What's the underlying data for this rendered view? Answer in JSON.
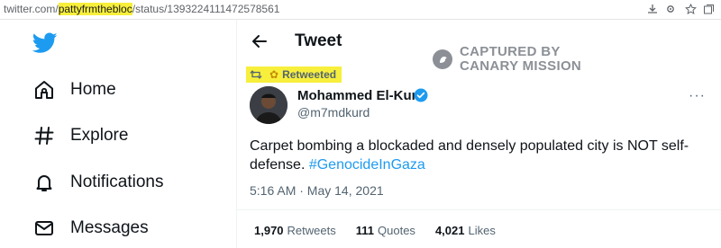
{
  "browser": {
    "url_domain": "twitter.com/",
    "url_highlight": "pattyfrmthebloc",
    "url_path": "/status/1393224111472578561"
  },
  "nav": {
    "items": [
      {
        "label": "Home",
        "icon": "home-icon"
      },
      {
        "label": "Explore",
        "icon": "hashtag-icon"
      },
      {
        "label": "Notifications",
        "icon": "bell-icon"
      },
      {
        "label": "Messages",
        "icon": "envelope-icon"
      }
    ]
  },
  "header": {
    "title": "Tweet"
  },
  "watermark": {
    "line1": "CAPTURED BY",
    "line2": "CANARY MISSION"
  },
  "tweet": {
    "retweeted_label": "Retweeted",
    "author_name": "Mohammed El-Kurd",
    "handle": "@m7mdkurd",
    "text_line1": "Carpet bombing a blockaded and densely populated city is NOT self-",
    "text_line2_prefix": "defense. ",
    "hashtag": "#GenocideInGaza",
    "timestamp": "5:16 AM · May 14, 2021",
    "stats": {
      "retweets_count": "1,970",
      "retweets_label": "Retweets",
      "quotes_count": "111",
      "quotes_label": "Quotes",
      "likes_count": "4,021",
      "likes_label": "Likes"
    }
  },
  "colors": {
    "accent": "#1d9bf0",
    "highlight": "#f7ef3c",
    "secondary_text": "#536471"
  }
}
